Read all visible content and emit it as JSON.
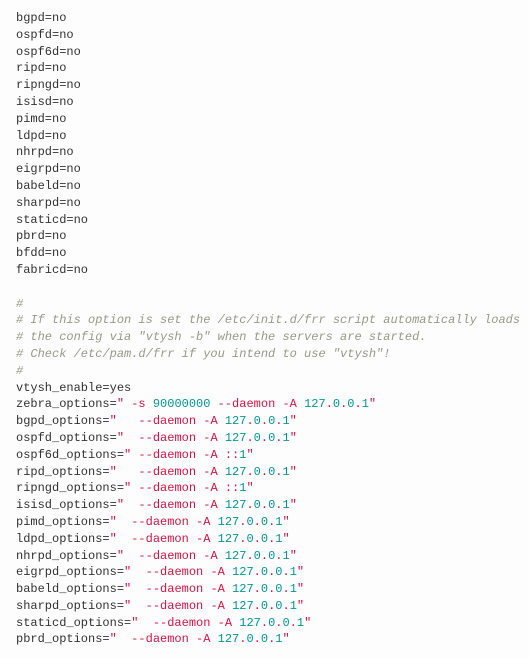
{
  "code": {
    "lines": [
      {
        "type": "assign",
        "key": "bgpd",
        "val": "no"
      },
      {
        "type": "assign",
        "key": "ospfd",
        "val": "no"
      },
      {
        "type": "assign",
        "key": "ospf6d",
        "val": "no"
      },
      {
        "type": "assign",
        "key": "ripd",
        "val": "no"
      },
      {
        "type": "assign",
        "key": "ripngd",
        "val": "no"
      },
      {
        "type": "assign",
        "key": "isisd",
        "val": "no"
      },
      {
        "type": "assign",
        "key": "pimd",
        "val": "no"
      },
      {
        "type": "assign",
        "key": "ldpd",
        "val": "no"
      },
      {
        "type": "assign",
        "key": "nhrpd",
        "val": "no"
      },
      {
        "type": "assign",
        "key": "eigrpd",
        "val": "no"
      },
      {
        "type": "assign",
        "key": "babeld",
        "val": "no"
      },
      {
        "type": "assign",
        "key": "sharpd",
        "val": "no"
      },
      {
        "type": "assign",
        "key": "staticd",
        "val": "no"
      },
      {
        "type": "assign",
        "key": "pbrd",
        "val": "no"
      },
      {
        "type": "assign",
        "key": "bfdd",
        "val": "no"
      },
      {
        "type": "assign",
        "key": "fabricd",
        "val": "no"
      },
      {
        "type": "blank"
      },
      {
        "type": "comment",
        "text": "#"
      },
      {
        "type": "comment",
        "text": "# If this option is set the /etc/init.d/frr script automatically loads"
      },
      {
        "type": "comment",
        "text": "# the config via \"vtysh -b\" when the servers are started."
      },
      {
        "type": "comment",
        "text": "# Check /etc/pam.d/frr if you intend to use \"vtysh\"!"
      },
      {
        "type": "comment",
        "text": "#"
      },
      {
        "type": "assign",
        "key": "vtysh_enable",
        "val": "yes"
      },
      {
        "type": "opt",
        "key": "zebra_options",
        "pre": "\" -s ",
        "num": "90000000",
        "mid": " --daemon -A ",
        "ip": [
          127,
          0,
          0,
          1
        ],
        "post": "\""
      },
      {
        "type": "opt",
        "key": "bgpd_options",
        "pre": "\"   --daemon -A ",
        "num": null,
        "mid": "",
        "ip": [
          127,
          0,
          0,
          1
        ],
        "post": "\""
      },
      {
        "type": "opt",
        "key": "ospfd_options",
        "pre": "\"  --daemon -A ",
        "num": null,
        "mid": "",
        "ip": [
          127,
          0,
          0,
          1
        ],
        "post": "\""
      },
      {
        "type": "optv6",
        "key": "ospf6d_options",
        "pre": "\" --daemon -A ::",
        "num": "1",
        "post": "\""
      },
      {
        "type": "opt",
        "key": "ripd_options",
        "pre": "\"   --daemon -A ",
        "num": null,
        "mid": "",
        "ip": [
          127,
          0,
          0,
          1
        ],
        "post": "\""
      },
      {
        "type": "optv6",
        "key": "ripngd_options",
        "pre": "\" --daemon -A ::",
        "num": "1",
        "post": "\""
      },
      {
        "type": "opt",
        "key": "isisd_options",
        "pre": "\"  --daemon -A ",
        "num": null,
        "mid": "",
        "ip": [
          127,
          0,
          0,
          1
        ],
        "post": "\""
      },
      {
        "type": "opt",
        "key": "pimd_options",
        "pre": "\"  --daemon -A ",
        "num": null,
        "mid": "",
        "ip": [
          127,
          0,
          0,
          1
        ],
        "post": "\""
      },
      {
        "type": "opt",
        "key": "ldpd_options",
        "pre": "\"  --daemon -A ",
        "num": null,
        "mid": "",
        "ip": [
          127,
          0,
          0,
          1
        ],
        "post": "\""
      },
      {
        "type": "opt",
        "key": "nhrpd_options",
        "pre": "\"  --daemon -A ",
        "num": null,
        "mid": "",
        "ip": [
          127,
          0,
          0,
          1
        ],
        "post": "\""
      },
      {
        "type": "opt",
        "key": "eigrpd_options",
        "pre": "\"  --daemon -A ",
        "num": null,
        "mid": "",
        "ip": [
          127,
          0,
          0,
          1
        ],
        "post": "\""
      },
      {
        "type": "opt",
        "key": "babeld_options",
        "pre": "\"  --daemon -A ",
        "num": null,
        "mid": "",
        "ip": [
          127,
          0,
          0,
          1
        ],
        "post": "\""
      },
      {
        "type": "opt",
        "key": "sharpd_options",
        "pre": "\"  --daemon -A ",
        "num": null,
        "mid": "",
        "ip": [
          127,
          0,
          0,
          1
        ],
        "post": "\""
      },
      {
        "type": "opt",
        "key": "staticd_options",
        "pre": "\"  --daemon -A ",
        "num": null,
        "mid": "",
        "ip": [
          127,
          0,
          0,
          1
        ],
        "post": "\""
      },
      {
        "type": "opt",
        "key": "pbrd_options",
        "pre": "\"  --daemon -A ",
        "num": null,
        "mid": "",
        "ip": [
          127,
          0,
          0,
          1
        ],
        "post": "\""
      }
    ]
  }
}
